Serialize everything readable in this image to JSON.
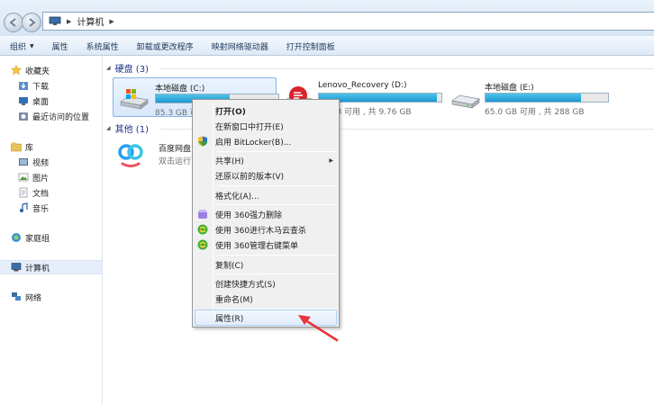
{
  "address": {
    "location": "计算机"
  },
  "toolbar": {
    "items": [
      "组织",
      "属性",
      "系统属性",
      "卸载或更改程序",
      "映射网络驱动器",
      "打开控制面板"
    ]
  },
  "nav": {
    "favorites": "收藏夹",
    "downloads": "下载",
    "desktop": "桌面",
    "recent": "最近访问的位置",
    "libraries": "库",
    "videos": "视频",
    "pictures": "图片",
    "documents": "文档",
    "music": "音乐",
    "homegroup": "家庭组",
    "computer": "计算机",
    "network": "网络"
  },
  "groups": {
    "hdd": "硬盘 (3)",
    "other": "其他 (1)"
  },
  "drives": [
    {
      "name": "本地磁盘 (C:)",
      "info": "85.3 GB 可用",
      "used_fraction": 0.6
    },
    {
      "name": "Lenovo_Recovery (D:)",
      "info": "GB 可用 , 共 9.76 GB",
      "used_fraction": 0.96
    },
    {
      "name": "本地磁盘 (E:)",
      "info": "65.0 GB 可用 , 共 288 GB",
      "used_fraction": 0.78
    }
  ],
  "apps": [
    {
      "name": "百度网盘",
      "desc": "双击运行百"
    }
  ],
  "context_menu": {
    "open": "打开(O)",
    "open_new_window": "在新窗口中打开(E)",
    "bitlocker": "启用 BitLocker(B)...",
    "share": "共享(H)",
    "restore": "还原以前的版本(V)",
    "format": "格式化(A)...",
    "delete_360": "使用 360强力删除",
    "scan_360": "使用 360进行木马云查杀",
    "manage_360": "使用 360管理右键菜单",
    "copy": "复制(C)",
    "shortcut": "创建快捷方式(S)",
    "rename": "重命名(M)",
    "properties": "属性(R)"
  },
  "colors": {
    "accent_bar": "#1e98d2",
    "arrow": "#e8343b"
  }
}
